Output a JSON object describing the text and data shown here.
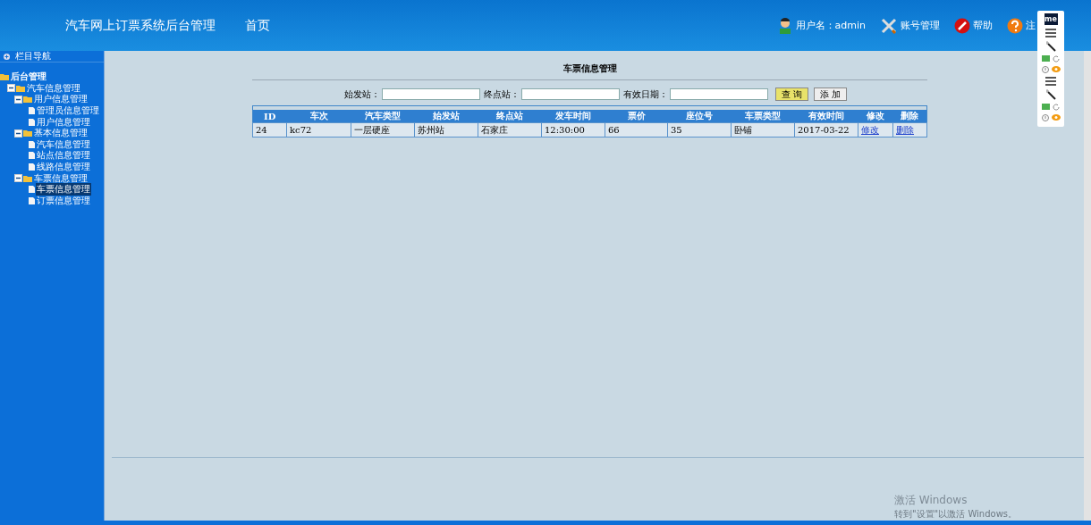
{
  "header": {
    "title": "汽车网上订票系统后台管理",
    "home": "首页",
    "user": "用户名：admin",
    "links": [
      {
        "kind": "tools",
        "label": "账号管理"
      },
      {
        "kind": "help",
        "label": "帮助"
      },
      {
        "kind": "question",
        "label": "注"
      }
    ]
  },
  "extension_panel": {
    "logo": "me"
  },
  "sidebar": {
    "title": "栏目导航",
    "tree": [
      {
        "label": "后台管理",
        "selected": false,
        "children": [
          {
            "label": "汽车信息管理",
            "expanded": true,
            "selected": false,
            "children": [
              {
                "label": "用户信息管理",
                "expanded": true,
                "selected": false,
                "children": [
                  {
                    "label": "管理员信息管理",
                    "selected": false
                  },
                  {
                    "label": "用户信息管理",
                    "selected": false
                  }
                ]
              },
              {
                "label": "基本信息管理",
                "expanded": true,
                "selected": false,
                "children": [
                  {
                    "label": "汽车信息管理",
                    "selected": false
                  },
                  {
                    "label": "站点信息管理",
                    "selected": false
                  },
                  {
                    "label": "线路信息管理",
                    "selected": false
                  }
                ]
              },
              {
                "label": "车票信息管理",
                "expanded": true,
                "selected": false,
                "children": [
                  {
                    "label": "车票信息管理",
                    "selected": true
                  },
                  {
                    "label": "订票信息管理",
                    "selected": false
                  }
                ]
              }
            ]
          }
        ]
      }
    ]
  },
  "main": {
    "title": "车票信息管理",
    "filters": [
      {
        "label": "始发站："
      },
      {
        "label": "终点站："
      },
      {
        "label": "有效日期："
      }
    ],
    "buttons": [
      "查 询",
      "添 加"
    ],
    "table": {
      "columns": [
        "ID",
        "车次",
        "汽车类型",
        "始发站",
        "终点站",
        "发车时间",
        "票价",
        "座位号",
        "车票类型",
        "有效时间",
        "修改",
        "删除"
      ],
      "rows": [
        {
          "cells": [
            "24",
            "kc72",
            "一层硬座",
            "苏州站",
            "石家庄",
            "12:30:00",
            "66",
            "35",
            "卧铺",
            "2017-03-22"
          ],
          "links": [
            "修改",
            "删除"
          ]
        }
      ]
    }
  },
  "watermark": {
    "title": "激活 Windows",
    "subtitle": "转到\"设置\"以激活 Windows。"
  }
}
